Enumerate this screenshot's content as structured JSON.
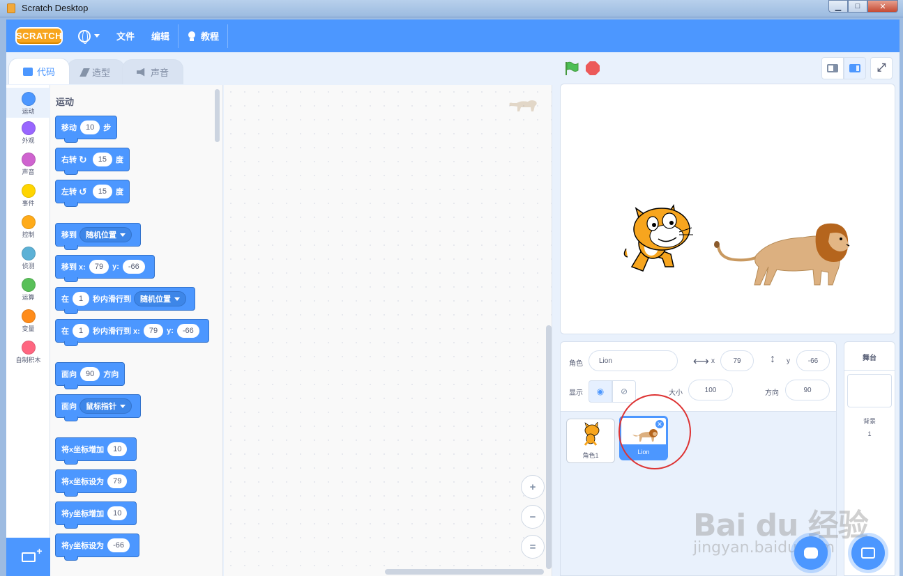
{
  "window": {
    "title": "Scratch Desktop",
    "min": "▁",
    "max": "□",
    "close": "✕"
  },
  "menu": {
    "logo": "SCRATCH",
    "file": "文件",
    "edit": "编辑",
    "tutorials": "教程"
  },
  "tabs": [
    {
      "label": "代码",
      "active": true
    },
    {
      "label": "造型",
      "active": false
    },
    {
      "label": "声音",
      "active": false
    }
  ],
  "categories": [
    {
      "label": "运动",
      "color": "#4c97ff"
    },
    {
      "label": "外观",
      "color": "#9966ff"
    },
    {
      "label": "声音",
      "color": "#cf63cf"
    },
    {
      "label": "事件",
      "color": "#ffd500"
    },
    {
      "label": "控制",
      "color": "#ffab19"
    },
    {
      "label": "侦测",
      "color": "#5cb1d6"
    },
    {
      "label": "运算",
      "color": "#59c059"
    },
    {
      "label": "变量",
      "color": "#ff8c1a"
    },
    {
      "label": "自制积木",
      "color": "#ff6680"
    }
  ],
  "palette": {
    "title": "运动",
    "move": {
      "a": "移动",
      "n": "10",
      "b": "步"
    },
    "turn_right": {
      "a": "右转",
      "n": "15",
      "b": "度"
    },
    "turn_left": {
      "a": "左转",
      "n": "15",
      "b": "度"
    },
    "goto": {
      "a": "移到",
      "d": "随机位置"
    },
    "goto_xy": {
      "a": "移到 x:",
      "x": "79",
      "yl": "y:",
      "y": "-66"
    },
    "glide": {
      "a": "在",
      "n": "1",
      "b": "秒内滑行到",
      "d": "随机位置"
    },
    "glide_xy": {
      "a": "在",
      "n": "1",
      "b": "秒内滑行到 x:",
      "x": "79",
      "yl": "y:",
      "y": "-66"
    },
    "point_dir": {
      "a": "面向",
      "n": "90",
      "b": "方向"
    },
    "point_towards": {
      "a": "面向",
      "d": "鼠标指针"
    },
    "change_x": {
      "a": "将x坐标增加",
      "n": "10"
    },
    "set_x": {
      "a": "将x坐标设为",
      "n": "79"
    },
    "change_y": {
      "a": "将y坐标增加",
      "n": "10"
    },
    "set_y": {
      "a": "将y坐标设为",
      "n": "-66"
    }
  },
  "zoom": {
    "in": "+",
    "out": "−",
    "reset": "="
  },
  "sprite_info": {
    "sprite_label": "角色",
    "sprite_name": "Lion",
    "x_label": "x",
    "x": "79",
    "y_label": "y",
    "y": "-66",
    "show_label": "显示",
    "size_label": "大小",
    "size": "100",
    "direction_label": "方向",
    "direction": "90"
  },
  "sprites": [
    {
      "name": "角色1",
      "selected": false
    },
    {
      "name": "Lion",
      "selected": true
    }
  ],
  "backdrop": {
    "title": "舞台",
    "label": "背景",
    "count": "1"
  },
  "watermark": {
    "line1": "Bai du 经验",
    "line2": "jingyan.baidu.com"
  }
}
